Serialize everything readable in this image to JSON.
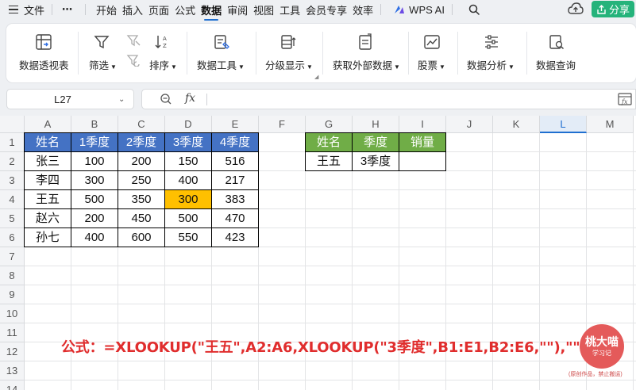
{
  "menu": {
    "file": "文件",
    "more": "⋯",
    "tabs": [
      "开始",
      "插入",
      "页面",
      "公式",
      "数据",
      "审阅",
      "视图",
      "工具",
      "会员专享",
      "效率"
    ],
    "active_tab": "数据",
    "wps_ai": "WPS AI",
    "share": "分享"
  },
  "ribbon": {
    "pivot": "数据透视表",
    "filter": "筛选",
    "sort": "排序",
    "data_tools": "数据工具",
    "outline": "分级显示",
    "external": "获取外部数据",
    "stocks": "股票",
    "analysis": "数据分析",
    "query": "数据查询"
  },
  "formula_bar": {
    "cell_ref": "L27",
    "fx": "fx",
    "content": ""
  },
  "sheet": {
    "columns": [
      "A",
      "B",
      "C",
      "D",
      "E",
      "F",
      "G",
      "H",
      "I",
      "J",
      "K",
      "L",
      "M"
    ],
    "selected_column": "L",
    "rows": [
      "1",
      "2",
      "3",
      "4",
      "5",
      "6",
      "7",
      "8",
      "9",
      "10",
      "11",
      "12",
      "13",
      "14"
    ],
    "table1": {
      "headers": [
        "姓名",
        "1季度",
        "2季度",
        "3季度",
        "4季度"
      ],
      "rows": [
        [
          "张三",
          "100",
          "200",
          "150",
          "516"
        ],
        [
          "李四",
          "300",
          "250",
          "400",
          "217"
        ],
        [
          "王五",
          "500",
          "350",
          "300",
          "383"
        ],
        [
          "赵六",
          "200",
          "450",
          "500",
          "470"
        ],
        [
          "孙七",
          "400",
          "600",
          "550",
          "423"
        ]
      ],
      "highlight_cell": "D4"
    },
    "table2": {
      "headers": [
        "姓名",
        "季度",
        "销量"
      ],
      "row": [
        "王五",
        "3季度",
        ""
      ]
    }
  },
  "annotation": {
    "formula": "公式：=XLOOKUP(\"王五\",A2:A6,XLOOKUP(\"3季度\",B1:E1,B2:E6,\"\"),\"\")"
  },
  "watermark": {
    "name": "桃大喵",
    "sub": "学习记",
    "note": "(原创作品，禁止搬运)"
  },
  "colors": {
    "accent": "#1f6fd0",
    "header_blue": "#4472c4",
    "header_green": "#70ad47",
    "highlight": "#ffc000",
    "formula_red": "#e02d2d",
    "share_green": "#25b37b",
    "logo_red": "#e45a5a"
  }
}
